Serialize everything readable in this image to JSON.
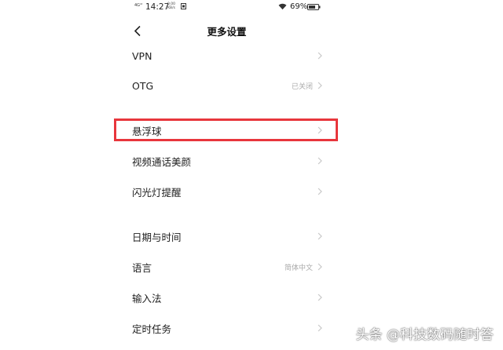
{
  "statusbar": {
    "signal": "4G¹ᵗ",
    "time": "14:27",
    "speed_value": "0.00",
    "speed_unit": "KB/s",
    "battery_percent": "69%"
  },
  "header": {
    "title": "更多设置"
  },
  "rows": [
    {
      "label": "VPN",
      "value": ""
    },
    {
      "label": "OTG",
      "value": "已关闭"
    },
    {
      "label": "悬浮球",
      "value": ""
    },
    {
      "label": "视频通话美颜",
      "value": ""
    },
    {
      "label": "闪光灯提醒",
      "value": ""
    },
    {
      "label": "日期与时间",
      "value": ""
    },
    {
      "label": "语言",
      "value": "简体中文"
    },
    {
      "label": "输入法",
      "value": ""
    },
    {
      "label": "定时任务",
      "value": ""
    }
  ],
  "watermark": "头条 @科技数码随时答",
  "colors": {
    "highlight": "#e8363c",
    "chevron": "#c8c8c8",
    "value_text": "#aaaaaa"
  }
}
